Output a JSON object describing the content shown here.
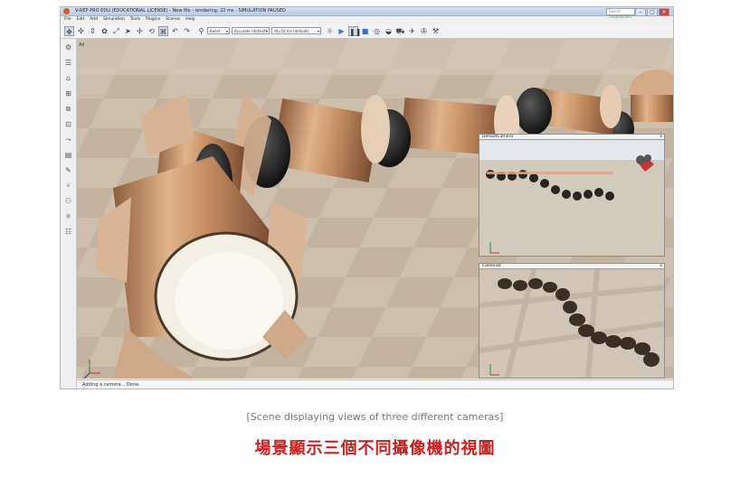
{
  "window": {
    "title": "V-REP PRO EDU (EDUCATIONAL LICENSE) - New file - rendering: 22 ms - SIMULATION PAUSED",
    "search_placeholder": "Search CoppeliaSim",
    "minimize": "–",
    "maximize": "□",
    "close": "✕"
  },
  "menu": [
    "File",
    "Edit",
    "Add",
    "Simulation",
    "Tools",
    "Plugins",
    "Scenes",
    "Help"
  ],
  "toolbar": {
    "selects": [
      {
        "label": "Bullet"
      },
      {
        "label": "Accurate (default)"
      },
      {
        "label": "dt=50 ms (default)"
      }
    ],
    "icons": [
      "camera-pan-icon",
      "camera-rotate-icon",
      "camera-shift-icon",
      "camera-angle-icon",
      "fit-view-icon",
      "object-shift-icon",
      "object-rotate-icon",
      "click-select-icon",
      "undo-icon",
      "redo-icon",
      "assembly-icon",
      "play-icon",
      "pause-icon",
      "stop-icon",
      "realtime-icon",
      "slower-icon",
      "faster-icon",
      "thread-icon",
      "visualize-icon"
    ]
  },
  "left_toolbar": {
    "icons": [
      "page-selector-icon",
      "scene-selector-icon",
      "zoom-icon",
      "camera-icon",
      "model-browser-icon",
      "scene-hierarchy-icon",
      "layers-icon",
      "calculation-icon",
      "path-icon",
      "collection-icon",
      "script-icon",
      "tree-icon",
      "user-settings-icon",
      "settings-icon",
      "shape-edit-icon"
    ]
  },
  "viewport": {
    "label": "All"
  },
  "subviews": [
    {
      "title": "DefaultCamera",
      "close": "x"
    },
    {
      "title": "Camera0",
      "close": "x"
    }
  ],
  "status": {
    "text": "Adding a camera... Done."
  },
  "captions": {
    "english": "[Scene displaying views of three different cameras]",
    "chinese": "場景顯示三個不同攝像機的視圖"
  },
  "colors": {
    "floor": "#cbbfaf",
    "caption_red": "#cc1f1f",
    "segment_wood": "#c99a74",
    "segment_dark": "#1d1d1d"
  }
}
